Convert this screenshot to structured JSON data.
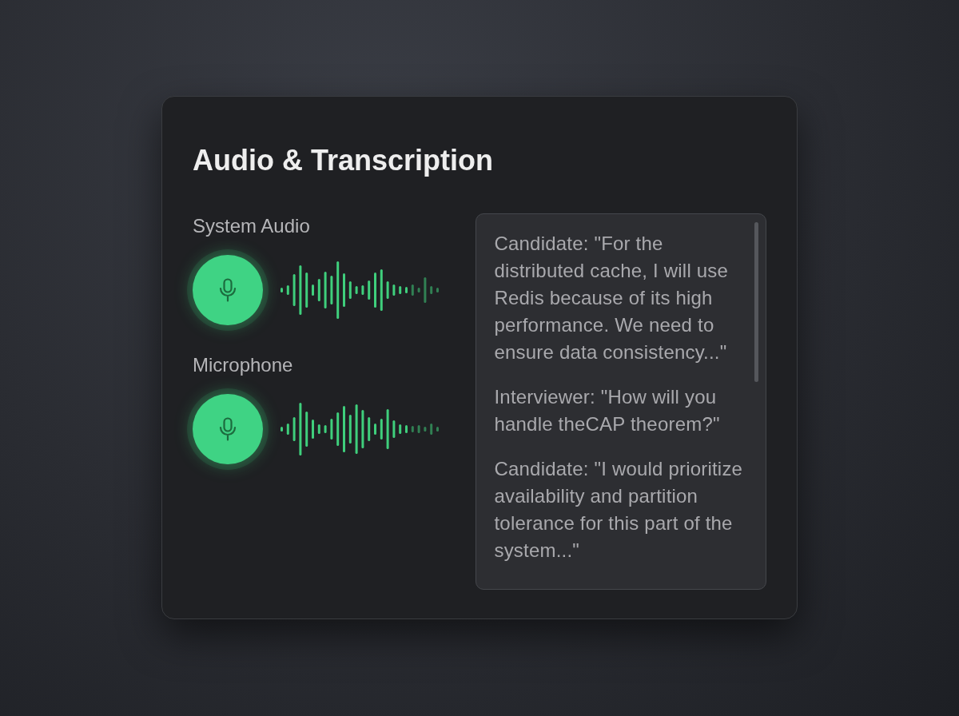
{
  "panel": {
    "title": "Audio & Transcription"
  },
  "sources": [
    {
      "label": "System Audio"
    },
    {
      "label": "Microphone"
    }
  ],
  "transcript": [
    "Candidate: \"For the distributed cache, I will use Redis because of its high performance. We need to ensure data consistency...\"",
    "Interviewer: \"How will you handle theCAP theorem?\"",
    "Candidate: \"I would prioritize availability and partition tolerance for this part of the system...\""
  ]
}
